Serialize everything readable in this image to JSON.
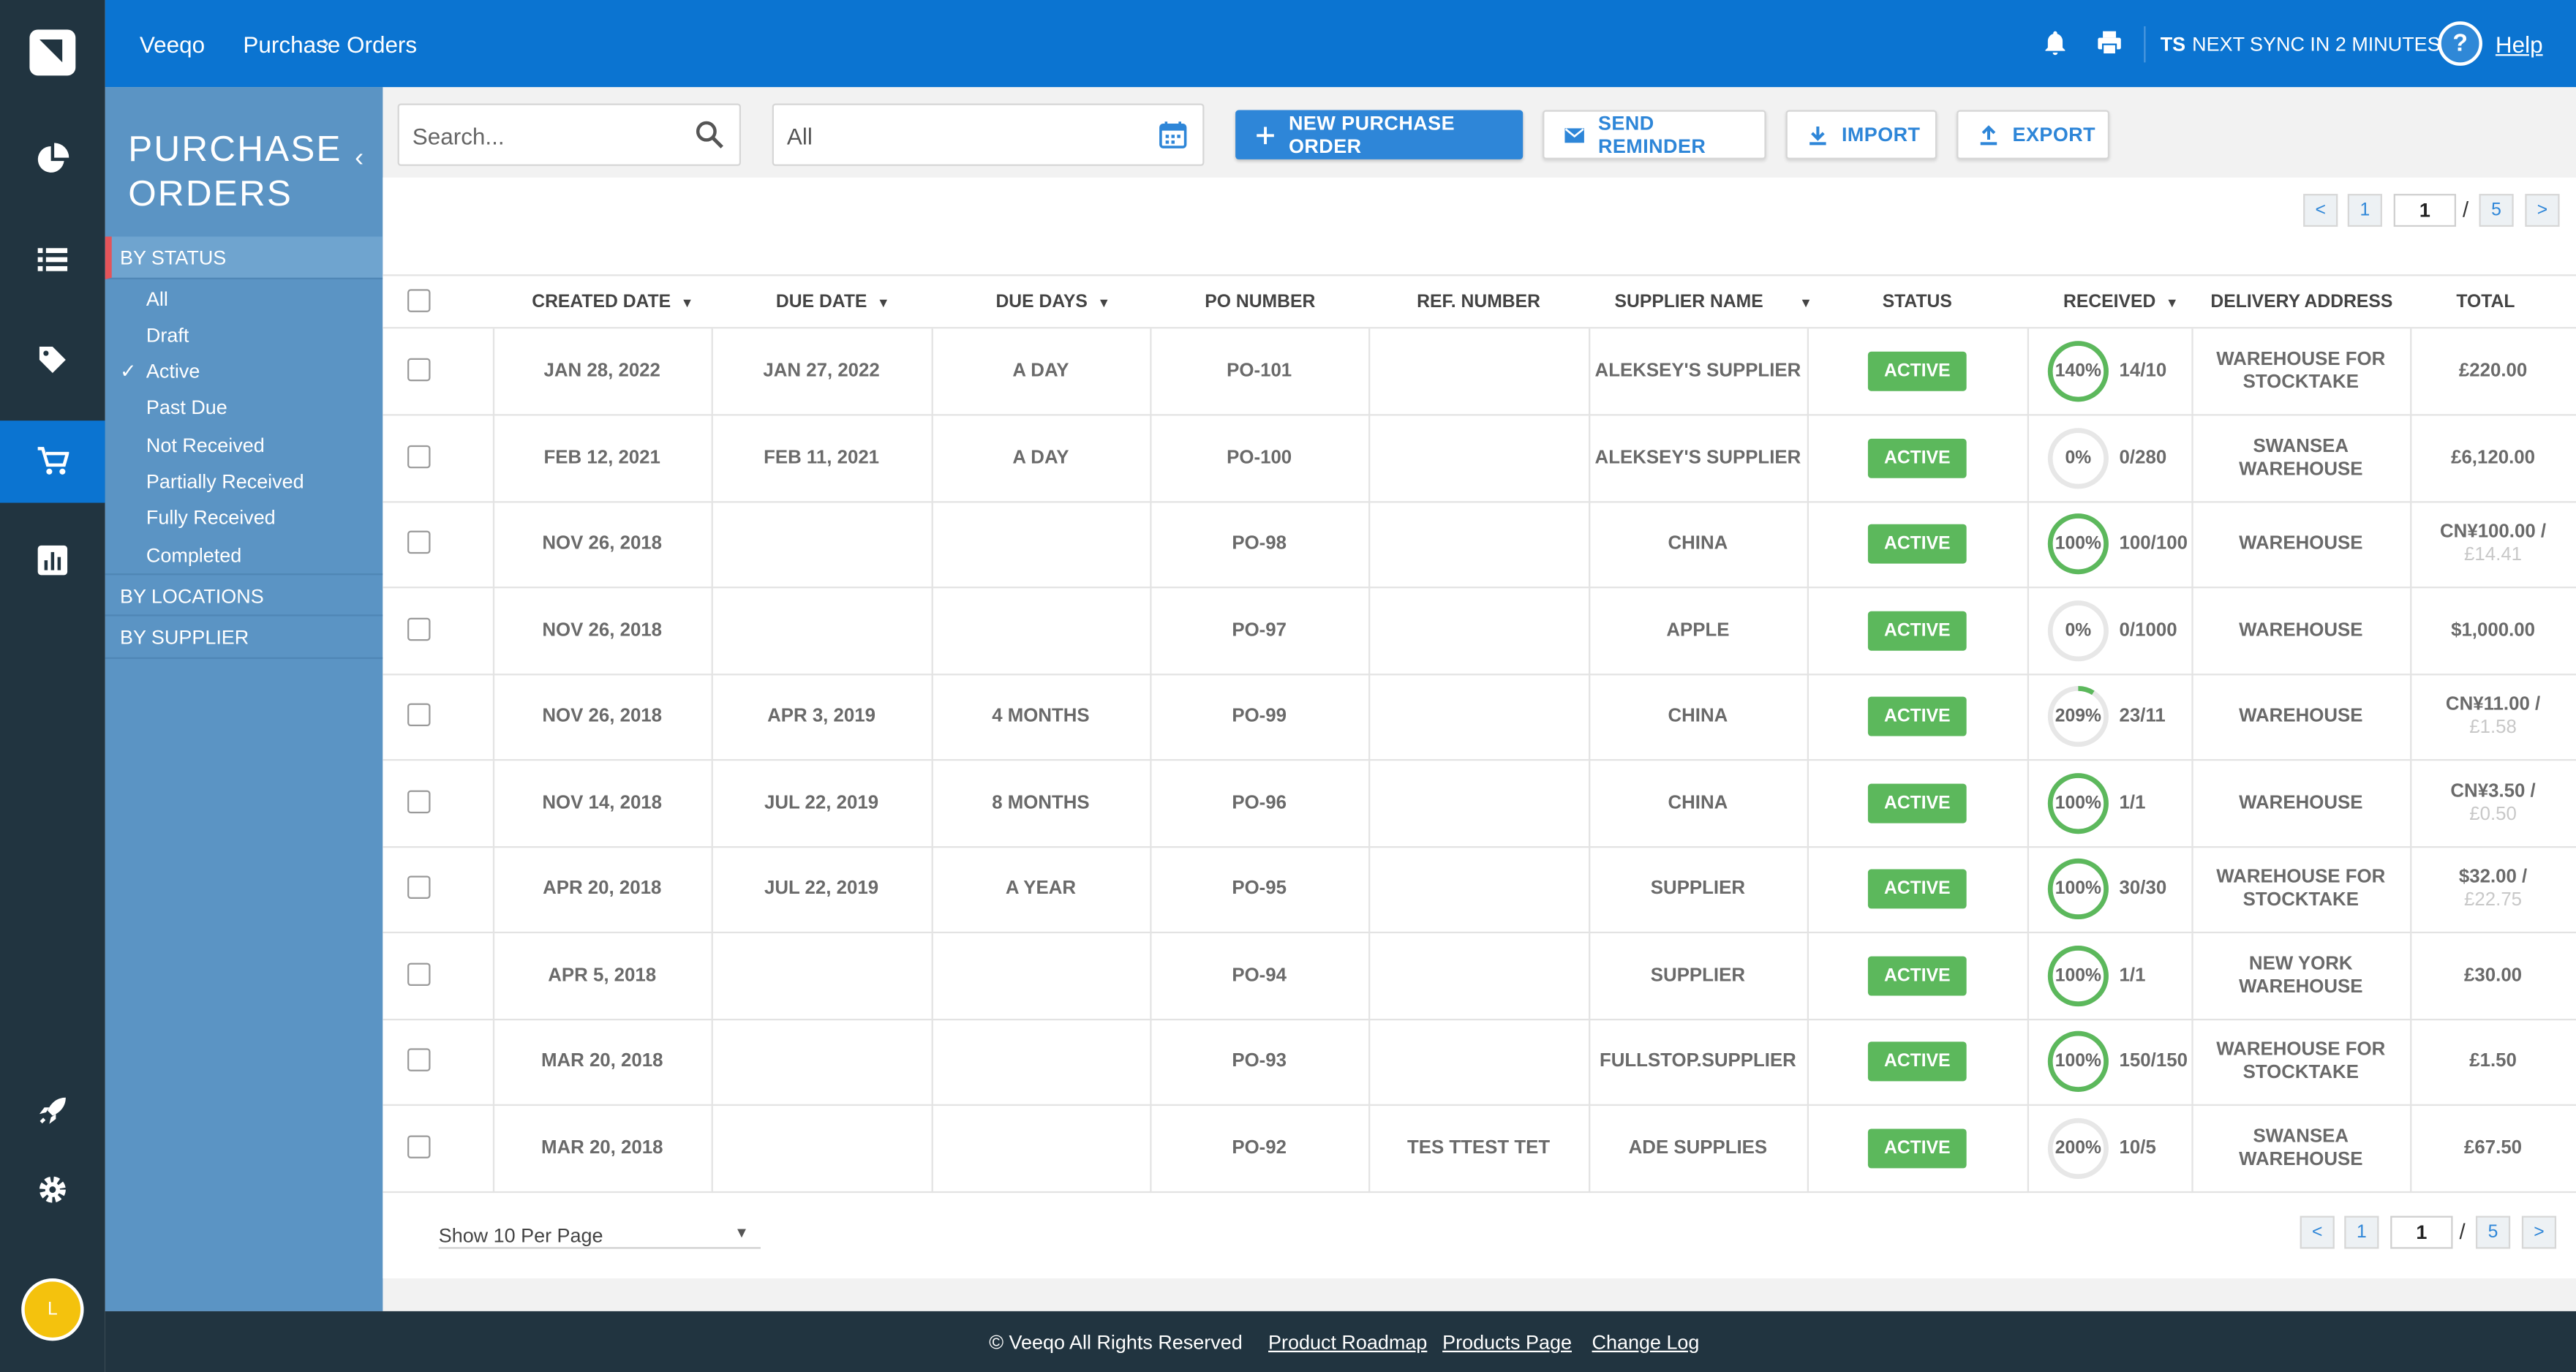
{
  "topbar": {
    "breadcrumb_root": "Veeqo",
    "breadcrumb_sep": "›",
    "breadcrumb_current": "Purchase Orders",
    "sync_initials": "TS",
    "sync_text": "NEXT SYNC IN 2 MINUTES",
    "help_label": "Help",
    "help_icon_glyph": "?"
  },
  "rail": {
    "icons": [
      "logo-icon",
      "dashboard-pie-icon",
      "orders-list-icon",
      "products-tag-icon",
      "purchase-cart-icon",
      "reports-chart-icon",
      "rocket-icon",
      "settings-gear-icon"
    ],
    "active": "purchase-cart-icon",
    "avatar_initial": "L",
    "avatar_color": "#f4c20d"
  },
  "sidebar": {
    "title": "PURCHASE ORDERS",
    "collapse_glyph": "‹",
    "by_status": "BY STATUS",
    "check_glyph": "✓",
    "status_items": [
      "All",
      "Draft",
      "Active",
      "Past Due",
      "Not Received",
      "Partially Received",
      "Fully Received",
      "Completed"
    ],
    "selected_status": "Active",
    "by_locations": "BY LOCATIONS",
    "by_supplier": "BY SUPPLIER"
  },
  "toolbar": {
    "search_placeholder": "Search...",
    "date_value": "All",
    "new_po": "NEW PURCHASE ORDER",
    "send_reminder": "SEND REMINDER",
    "import": "IMPORT",
    "export": "EXPORT"
  },
  "pagination": {
    "prev": "<",
    "first": "1",
    "current": "1",
    "slash": "/",
    "last": "5",
    "next": ">"
  },
  "table": {
    "columns": [
      "CREATED DATE",
      "DUE DATE",
      "DUE DAYS",
      "PO NUMBER",
      "REF. NUMBER",
      "SUPPLIER NAME",
      "STATUS",
      "RECEIVED",
      "DELIVERY ADDRESS",
      "TOTAL"
    ],
    "sortable_caret": "▼",
    "rows": [
      {
        "created": "JAN 28, 2022",
        "due": "JAN 27, 2022",
        "due_days": "A DAY",
        "po": "PO-101",
        "ref": "",
        "supplier": "ALEKSEY'S SUPPLIER",
        "status": "ACTIVE",
        "received_pct": "140%",
        "received_fraction": 1.4,
        "received": "14/10",
        "address": "WAREHOUSE FOR STOCKTAKE",
        "total": "£220.00",
        "total_converted": ""
      },
      {
        "created": "FEB 12, 2021",
        "due": "FEB 11, 2021",
        "due_days": "A DAY",
        "po": "PO-100",
        "ref": "",
        "supplier": "ALEKSEY'S SUPPLIER",
        "status": "ACTIVE",
        "received_pct": "0%",
        "received_fraction": 0,
        "received": "0/280",
        "address": "SWANSEA WAREHOUSE",
        "total": "£6,120.00",
        "total_converted": ""
      },
      {
        "created": "NOV 26, 2018",
        "due": "",
        "due_days": "",
        "po": "PO-98",
        "ref": "",
        "supplier": "CHINA",
        "status": "ACTIVE",
        "received_pct": "100%",
        "received_fraction": 1.0,
        "received": "100/100",
        "address": "WAREHOUSE",
        "total": "CN¥100.00 /",
        "total_converted": "£14.41"
      },
      {
        "created": "NOV 26, 2018",
        "due": "",
        "due_days": "",
        "po": "PO-97",
        "ref": "",
        "supplier": "APPLE",
        "status": "ACTIVE",
        "received_pct": "0%",
        "received_fraction": 0,
        "received": "0/1000",
        "address": "WAREHOUSE",
        "total": "$1,000.00",
        "total_converted": ""
      },
      {
        "created": "NOV 26, 2018",
        "due": "APR 3, 2019",
        "due_days": "4 MONTHS",
        "po": "PO-99",
        "ref": "",
        "supplier": "CHINA",
        "status": "ACTIVE",
        "received_pct": "209%",
        "received_fraction": 0.09,
        "received": "23/11",
        "address": "WAREHOUSE",
        "total": "CN¥11.00 /",
        "total_converted": "£1.58"
      },
      {
        "created": "NOV 14, 2018",
        "due": "JUL 22, 2019",
        "due_days": "8 MONTHS",
        "po": "PO-96",
        "ref": "",
        "supplier": "CHINA",
        "status": "ACTIVE",
        "received_pct": "100%",
        "received_fraction": 1.0,
        "received": "1/1",
        "address": "WAREHOUSE",
        "total": "CN¥3.50 /",
        "total_converted": "£0.50"
      },
      {
        "created": "APR 20, 2018",
        "due": "JUL 22, 2019",
        "due_days": "A YEAR",
        "po": "PO-95",
        "ref": "",
        "supplier": "SUPPLIER",
        "status": "ACTIVE",
        "received_pct": "100%",
        "received_fraction": 1.0,
        "received": "30/30",
        "address": "WAREHOUSE FOR STOCKTAKE",
        "total": "$32.00 /",
        "total_converted": "£22.75"
      },
      {
        "created": "APR 5, 2018",
        "due": "",
        "due_days": "",
        "po": "PO-94",
        "ref": "",
        "supplier": "SUPPLIER",
        "status": "ACTIVE",
        "received_pct": "100%",
        "received_fraction": 1.0,
        "received": "1/1",
        "address": "NEW YORK WAREHOUSE",
        "total": "£30.00",
        "total_converted": ""
      },
      {
        "created": "MAR 20, 2018",
        "due": "",
        "due_days": "",
        "po": "PO-93",
        "ref": "",
        "supplier": "FULLSTOP.SUPPLIER",
        "status": "ACTIVE",
        "received_pct": "100%",
        "received_fraction": 1.0,
        "received": "150/150",
        "address": "WAREHOUSE FOR STOCKTAKE",
        "total": "£1.50",
        "total_converted": ""
      },
      {
        "created": "MAR 20, 2018",
        "due": "",
        "due_days": "",
        "po": "PO-92",
        "ref": "TES TTEST TET",
        "supplier": "ADE SUPPLIES",
        "status": "ACTIVE",
        "received_pct": "200%",
        "received_fraction": 0,
        "received": "10/5",
        "address": "SWANSEA WAREHOUSE",
        "total": "£67.50",
        "total_converted": ""
      }
    ]
  },
  "per_page": {
    "label": "Show 10 Per Page",
    "caret": "▼"
  },
  "footer": {
    "copyright": "© Veeqo All Rights Reserved",
    "roadmap": "Product Roadmap",
    "products": "Products Page",
    "changelog": "Change Log"
  },
  "colors": {
    "primary": "#0b74d1",
    "sidebar": "#5b94c4",
    "rail": "#213440",
    "active_badge": "#5cb85c",
    "ring": "#5cb85c",
    "active_marker": "#e4545a"
  }
}
